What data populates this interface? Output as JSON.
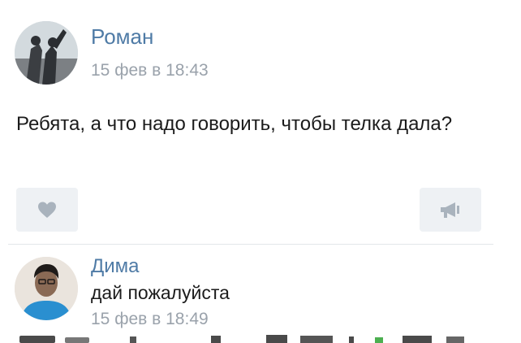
{
  "post": {
    "author": "Роман",
    "date": "15 фев в 18:43",
    "text": "Ребята, а что надо говорить, чтобы телка дала?",
    "avatar_icon": "user-avatar-photo",
    "like_icon": "heart-icon",
    "share_icon": "megaphone-icon"
  },
  "comment": {
    "author": "Дима",
    "text": "дай пожалуйста",
    "date": "15 фев в 18:49",
    "avatar_icon": "user-avatar-photo"
  },
  "colors": {
    "author_link": "#4f7ba6",
    "timestamp": "#9aa2ab",
    "button_bg": "#eef1f4",
    "icon": "#a9b3bd"
  }
}
